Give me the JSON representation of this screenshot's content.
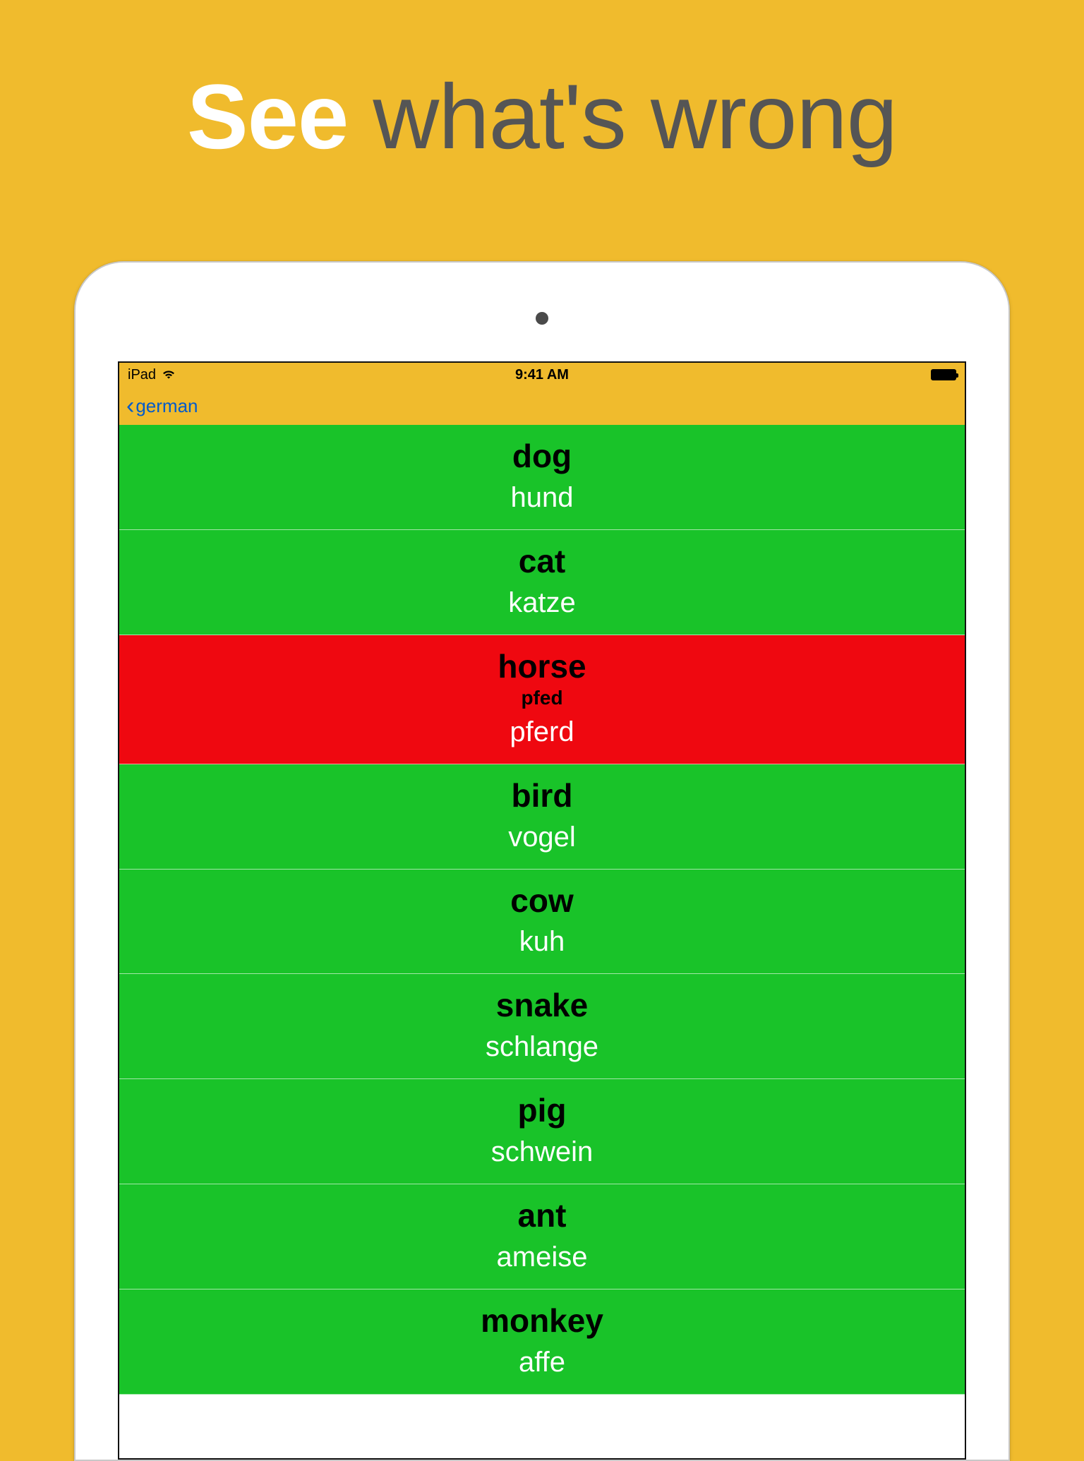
{
  "headline": {
    "emphasis": "See",
    "rest": " what's wrong"
  },
  "statusbar": {
    "device": "iPad",
    "time": "9:41 AM"
  },
  "navbar": {
    "back_label": "german"
  },
  "colors": {
    "background": "#f0bb2d",
    "correct": "#19c329",
    "wrong": "#ef0810",
    "link": "#035bca"
  },
  "results": [
    {
      "word": "dog",
      "translation": "hund",
      "correct": true
    },
    {
      "word": "cat",
      "translation": "katze",
      "correct": true
    },
    {
      "word": "horse",
      "translation": "pferd",
      "correct": false,
      "user_answer": "pfed"
    },
    {
      "word": "bird",
      "translation": "vogel",
      "correct": true
    },
    {
      "word": "cow",
      "translation": "kuh",
      "correct": true
    },
    {
      "word": "snake",
      "translation": "schlange",
      "correct": true
    },
    {
      "word": "pig",
      "translation": "schwein",
      "correct": true
    },
    {
      "word": "ant",
      "translation": "ameise",
      "correct": true
    },
    {
      "word": "monkey",
      "translation": "affe",
      "correct": true
    }
  ]
}
